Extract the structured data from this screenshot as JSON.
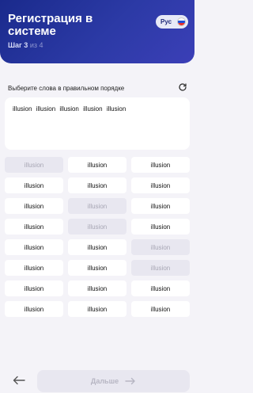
{
  "header": {
    "title": "Регистрация в системе",
    "step_prefix": "Шаг 3",
    "step_suffix": "из 4",
    "lang_label": "Рус",
    "lang_flag_icon": "russia-flag-icon"
  },
  "main": {
    "instruction": "Выберите слова в правильном порядке",
    "refresh_icon": "refresh-icon",
    "selected_words": [
      "illusion",
      "illusion",
      "illusion",
      "illusion",
      "illusion"
    ],
    "word_options": [
      {
        "label": "illusion",
        "used": true
      },
      {
        "label": "illusion",
        "used": false
      },
      {
        "label": "illusion",
        "used": false
      },
      {
        "label": "illusion",
        "used": false
      },
      {
        "label": "illusion",
        "used": false
      },
      {
        "label": "illusion",
        "used": false
      },
      {
        "label": "illusion",
        "used": false
      },
      {
        "label": "illusion",
        "used": true
      },
      {
        "label": "illusion",
        "used": false
      },
      {
        "label": "illusion",
        "used": false
      },
      {
        "label": "illusion",
        "used": true
      },
      {
        "label": "illusion",
        "used": false
      },
      {
        "label": "illusion",
        "used": false
      },
      {
        "label": "illusion",
        "used": false
      },
      {
        "label": "illusion",
        "used": true
      },
      {
        "label": "illusion",
        "used": false
      },
      {
        "label": "illusion",
        "used": false
      },
      {
        "label": "illusion",
        "used": true
      },
      {
        "label": "illusion",
        "used": false
      },
      {
        "label": "illusion",
        "used": false
      },
      {
        "label": "illusion",
        "used": false
      },
      {
        "label": "illusion",
        "used": false
      },
      {
        "label": "illusion",
        "used": false
      },
      {
        "label": "illusion",
        "used": false
      }
    ]
  },
  "footer": {
    "next_label": "Дальше",
    "back_icon": "arrow-left-icon",
    "next_icon": "arrow-right-icon"
  },
  "colors": {
    "header_start": "#1a2a8c",
    "header_end": "#3b3fb7",
    "background": "#f4f3f8",
    "chip_used": "#e8e7f0"
  }
}
